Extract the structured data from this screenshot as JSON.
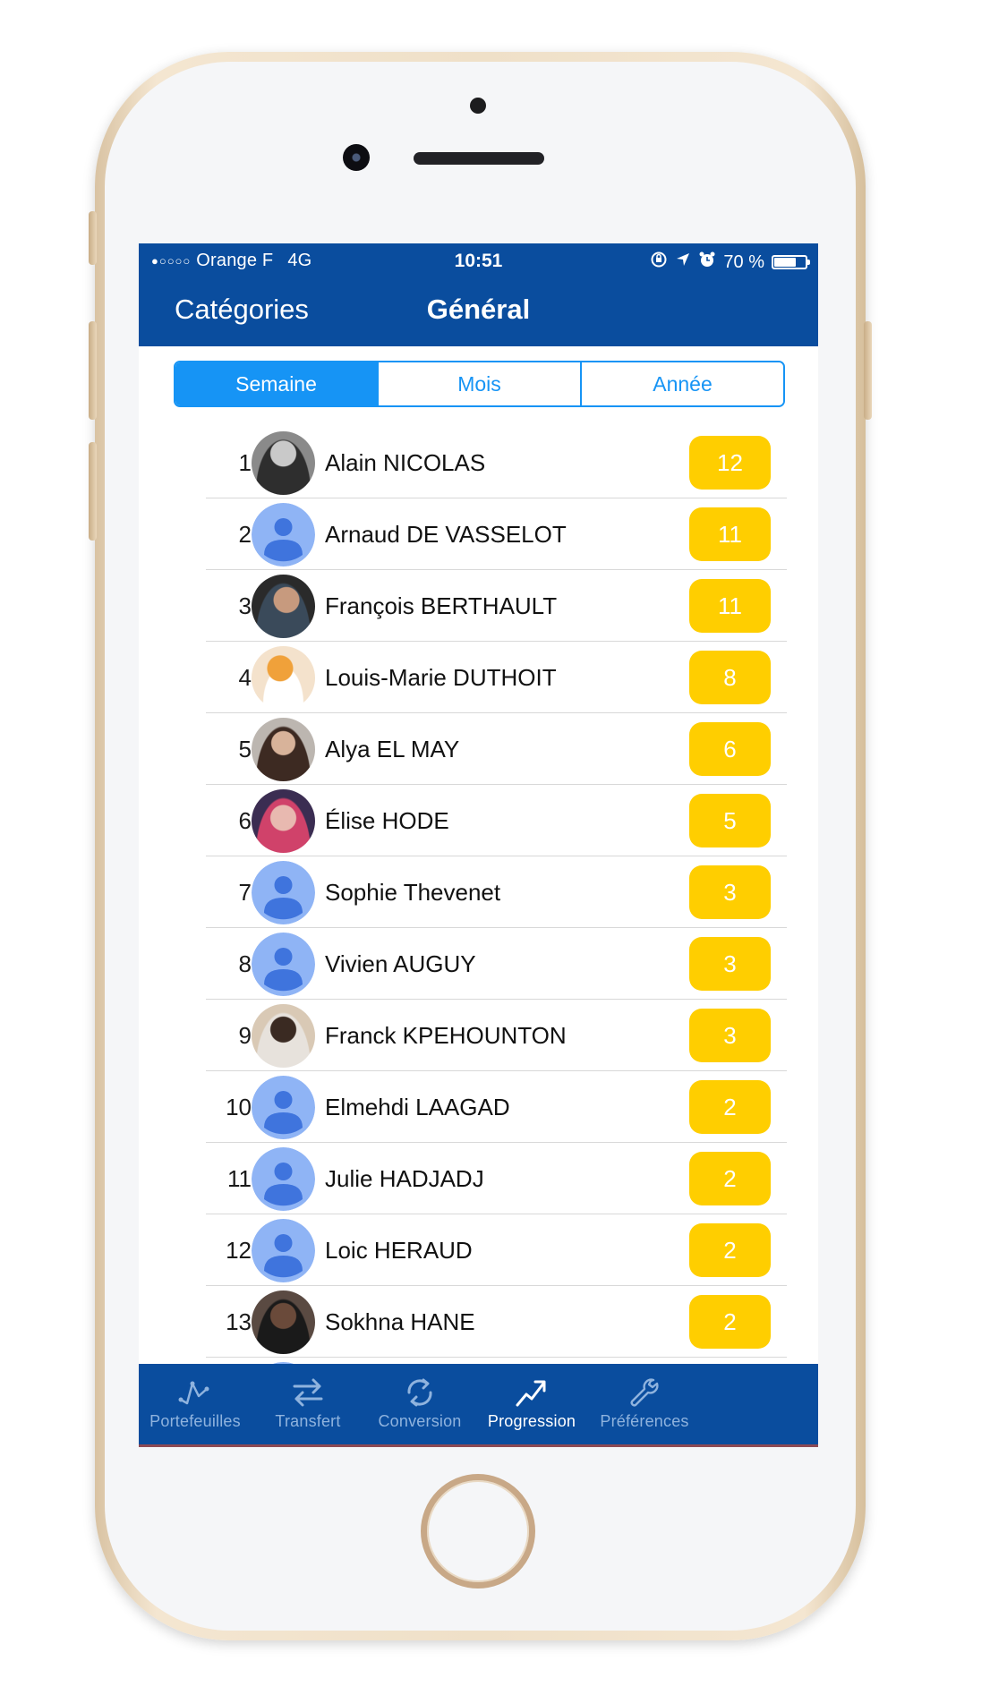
{
  "status_bar": {
    "carrier": "Orange F",
    "network": "4G",
    "time": "10:51",
    "battery": "70 %"
  },
  "nav": {
    "back_label": "Catégories",
    "title": "Général"
  },
  "segments": [
    {
      "label": "Semaine",
      "selected": true
    },
    {
      "label": "Mois",
      "selected": false
    },
    {
      "label": "Année",
      "selected": false
    }
  ],
  "ranking": [
    {
      "rank": "1",
      "name": "Alain NICOLAS",
      "score": "12",
      "avatar": "photo"
    },
    {
      "rank": "2",
      "name": "Arnaud DE VASSELOT",
      "score": "11",
      "avatar": "default"
    },
    {
      "rank": "3",
      "name": "François BERTHAULT",
      "score": "11",
      "avatar": "photo"
    },
    {
      "rank": "4",
      "name": "Louis-Marie DUTHOIT",
      "score": "8",
      "avatar": "photo"
    },
    {
      "rank": "5",
      "name": "Alya EL MAY",
      "score": "6",
      "avatar": "photo"
    },
    {
      "rank": "6",
      "name": "Élise HODE",
      "score": "5",
      "avatar": "photo"
    },
    {
      "rank": "7",
      "name": "Sophie Thevenet",
      "score": "3",
      "avatar": "default"
    },
    {
      "rank": "8",
      "name": "Vivien AUGUY",
      "score": "3",
      "avatar": "default"
    },
    {
      "rank": "9",
      "name": "Franck KPEHOUNTON",
      "score": "3",
      "avatar": "photo"
    },
    {
      "rank": "10",
      "name": "Elmehdi LAAGAD",
      "score": "2",
      "avatar": "default"
    },
    {
      "rank": "11",
      "name": "Julie HADJADJ",
      "score": "2",
      "avatar": "default"
    },
    {
      "rank": "12",
      "name": "Loic HERAUD",
      "score": "2",
      "avatar": "default"
    },
    {
      "rank": "13",
      "name": "Sokhna HANE",
      "score": "2",
      "avatar": "photo"
    }
  ],
  "tabs": [
    {
      "label": "Portefeuilles",
      "icon": "portfolio-chart-icon",
      "selected": false
    },
    {
      "label": "Transfert",
      "icon": "transfer-arrows-icon",
      "selected": false
    },
    {
      "label": "Conversion",
      "icon": "refresh-icon",
      "selected": false
    },
    {
      "label": "Progression",
      "icon": "trending-up-icon",
      "selected": true
    },
    {
      "label": "Préférences",
      "icon": "wrench-icon",
      "selected": false
    }
  ],
  "colors": {
    "header_blue": "#0a4d9e",
    "segment_blue": "#1694f5",
    "badge_yellow": "#ffce00",
    "default_avatar_blue": "#8fb4f5"
  }
}
